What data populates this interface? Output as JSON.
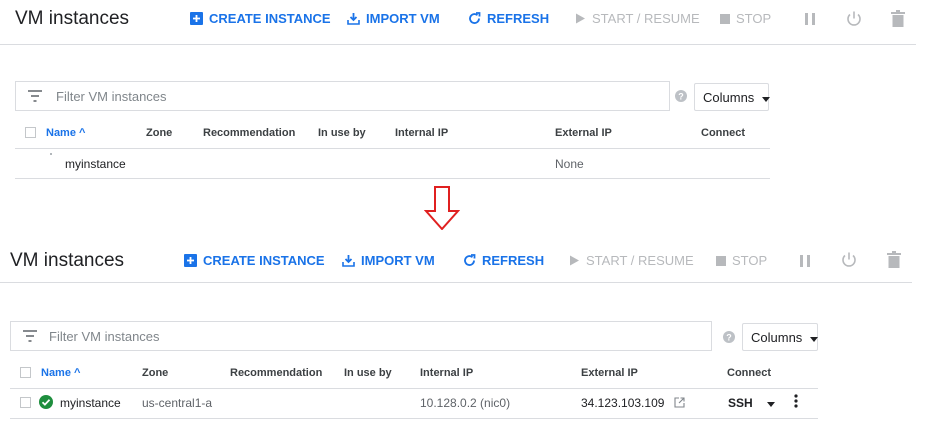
{
  "page_title": "VM instances",
  "toolbar": {
    "create_label": "CREATE INSTANCE",
    "import_label": "IMPORT VM",
    "refresh_label": "REFRESH",
    "start_label": "START / RESUME",
    "stop_label": "STOP"
  },
  "filter": {
    "placeholder": "Filter VM instances"
  },
  "columns_button": "Columns",
  "table": {
    "headers": [
      "Name",
      "Zone",
      "Recommendation",
      "In use by",
      "Internal IP",
      "External IP",
      "Connect"
    ],
    "sort_indicator": "^"
  },
  "before": {
    "row": {
      "name": "myinstance",
      "zone": "",
      "internal_ip": "",
      "external_ip": "None"
    }
  },
  "after": {
    "row": {
      "name": "myinstance",
      "zone": "us-central1-a",
      "internal_ip": "10.128.0.2 (nic0)",
      "external_ip": "34.123.103.109",
      "connect": "SSH"
    }
  },
  "colors": {
    "accent": "#1a73e8",
    "disabled": "#b7b9bc",
    "status_ok": "#1e8e3e",
    "arrow": "#e02020"
  },
  "icons": [
    "create-instance-icon",
    "import-vm-icon",
    "refresh-icon",
    "play-icon",
    "stop-icon",
    "pause-icon",
    "power-icon",
    "trash-icon",
    "filter-icon",
    "help-icon",
    "chevron-down-icon",
    "status-ok-icon",
    "external-link-icon",
    "kebab-menu-icon",
    "down-arrow-icon"
  ]
}
